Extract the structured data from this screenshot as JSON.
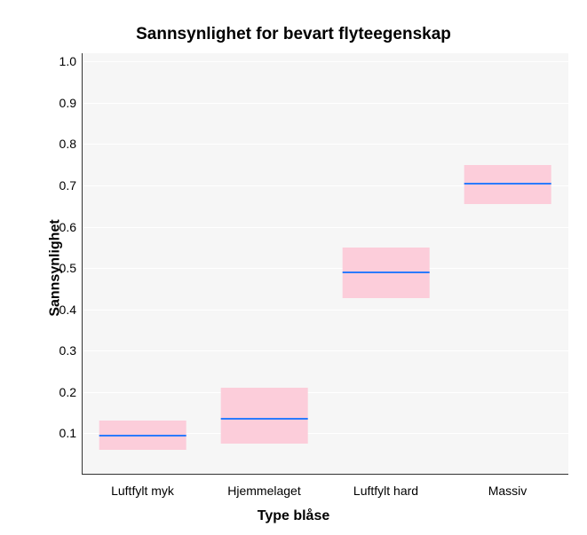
{
  "chart_data": {
    "type": "box",
    "title": "Sannsynlighet for bevart flyteegenskap",
    "xlabel": "Type blåse",
    "ylabel": "Sannsynlighet",
    "ylim": [
      0,
      1.02
    ],
    "yticks": [
      0.1,
      0.2,
      0.3,
      0.4,
      0.5,
      0.6,
      0.7,
      0.8,
      0.9,
      1.0
    ],
    "categories": [
      "Luftfylt myk",
      "Hjemmelaget",
      "Luftfylt hard",
      "Massiv"
    ],
    "series": [
      {
        "name": "Luftfylt myk",
        "median": 0.095,
        "lower": 0.06,
        "upper": 0.13
      },
      {
        "name": "Hjemmelaget",
        "median": 0.135,
        "lower": 0.075,
        "upper": 0.21
      },
      {
        "name": "Luftfylt hard",
        "median": 0.49,
        "lower": 0.428,
        "upper": 0.55
      },
      {
        "name": "Massiv",
        "median": 0.705,
        "lower": 0.655,
        "upper": 0.75
      }
    ]
  }
}
